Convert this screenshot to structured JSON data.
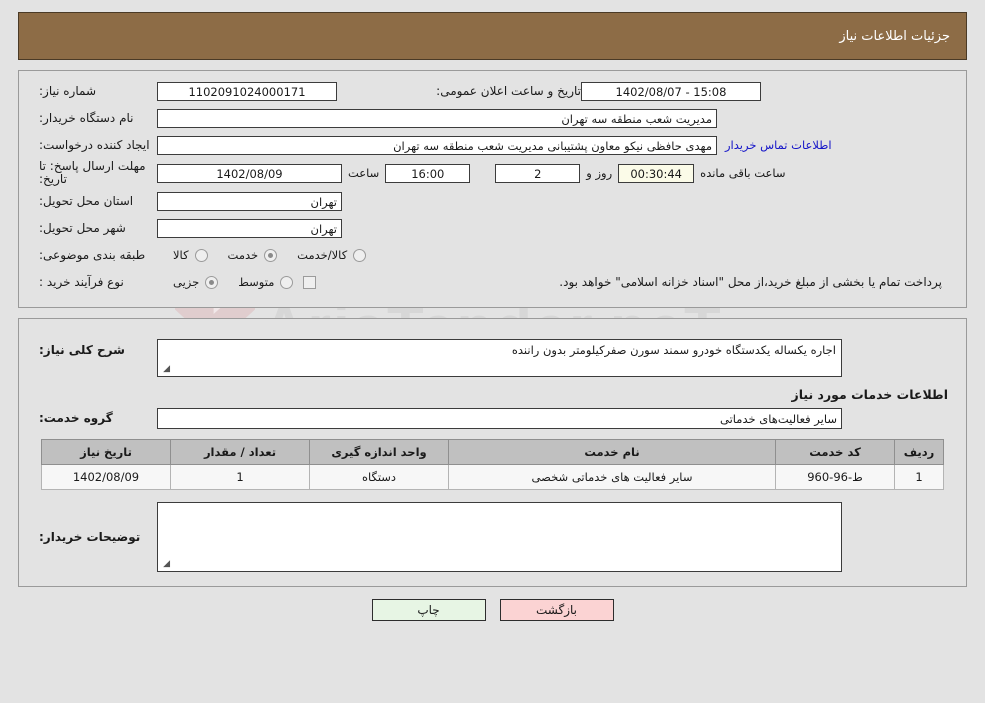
{
  "header": {
    "title": "جزئیات اطلاعات نیاز"
  },
  "form": {
    "need_number_label": "شماره نیاز:",
    "need_number_value": "1102091024000171",
    "public_announce_label": "تاریخ و ساعت اعلان عمومی:",
    "public_announce_value": "15:08 - 1402/08/07",
    "buyer_org_label": "نام دستگاه خریدار:",
    "buyer_org_value": "مدیریت شعب منطقه سه تهران",
    "creator_label": "ایجاد کننده درخواست:",
    "creator_value": "مهدی حافظی نیکو معاون پشتیبانی مدیریت شعب منطقه سه تهران",
    "contact_link": "اطلاعات تماس خریدار",
    "deadline_label": "مهلت ارسال پاسخ: تا تاریخ:",
    "deadline_date": "1402/08/09",
    "hour_label": "ساعت",
    "deadline_time": "16:00",
    "days_value": "2",
    "days_label": "روز و",
    "countdown_value": "00:30:44",
    "remaining_label": "ساعت باقی مانده",
    "province_label": "استان محل تحویل:",
    "province_value": "تهران",
    "city_label": "شهر محل تحویل:",
    "city_value": "تهران",
    "category_label": "طبقه بندی موضوعی:",
    "category_options": [
      {
        "label": "کالا",
        "selected": false
      },
      {
        "label": "خدمت",
        "selected": true
      },
      {
        "label": "کالا/خدمت",
        "selected": false
      }
    ],
    "process_label": "نوع فرآیند خرید :",
    "process_options": [
      {
        "label": "جزیی",
        "selected": true
      },
      {
        "label": "متوسط",
        "selected": false
      }
    ],
    "treasury_checkbox_checked": false,
    "treasury_text": "پرداخت تمام یا بخشی از مبلغ خرید،از محل \"اسناد خزانه اسلامی\" خواهد بود."
  },
  "description": {
    "label": "شرح کلی نیاز:",
    "value": "اجاره یکساله یکدستگاه خودرو سمند سورن صفرکیلومتر بدون راننده"
  },
  "services": {
    "section_heading": "اطلاعات خدمات مورد نیاز",
    "group_label": "گروه خدمت:",
    "group_value": "سایر فعالیت‌های خدماتی",
    "columns": [
      "ردیف",
      "کد خدمت",
      "نام خدمت",
      "واحد اندازه گیری",
      "تعداد / مقدار",
      "تاریخ نیاز"
    ],
    "rows": [
      {
        "index": "1",
        "code": "ط-96-960",
        "name": "سایر فعالیت های خدماتی شخصی",
        "unit": "دستگاه",
        "quantity": "1",
        "need_date": "1402/08/09"
      }
    ]
  },
  "buyer_notes": {
    "label": "توضیحات خریدار:",
    "value": ""
  },
  "buttons": {
    "print": "چاپ",
    "back": "بازگشت"
  },
  "watermark": {
    "text": "AriaTender.neT"
  },
  "colors": {
    "header_bg": "#8d6c46",
    "page_bg": "#e3e3e3",
    "link": "#1414c8",
    "print_btn": "#e7f5e4",
    "back_btn": "#fbd3d3",
    "countdown_bg": "#fbfbe8"
  }
}
